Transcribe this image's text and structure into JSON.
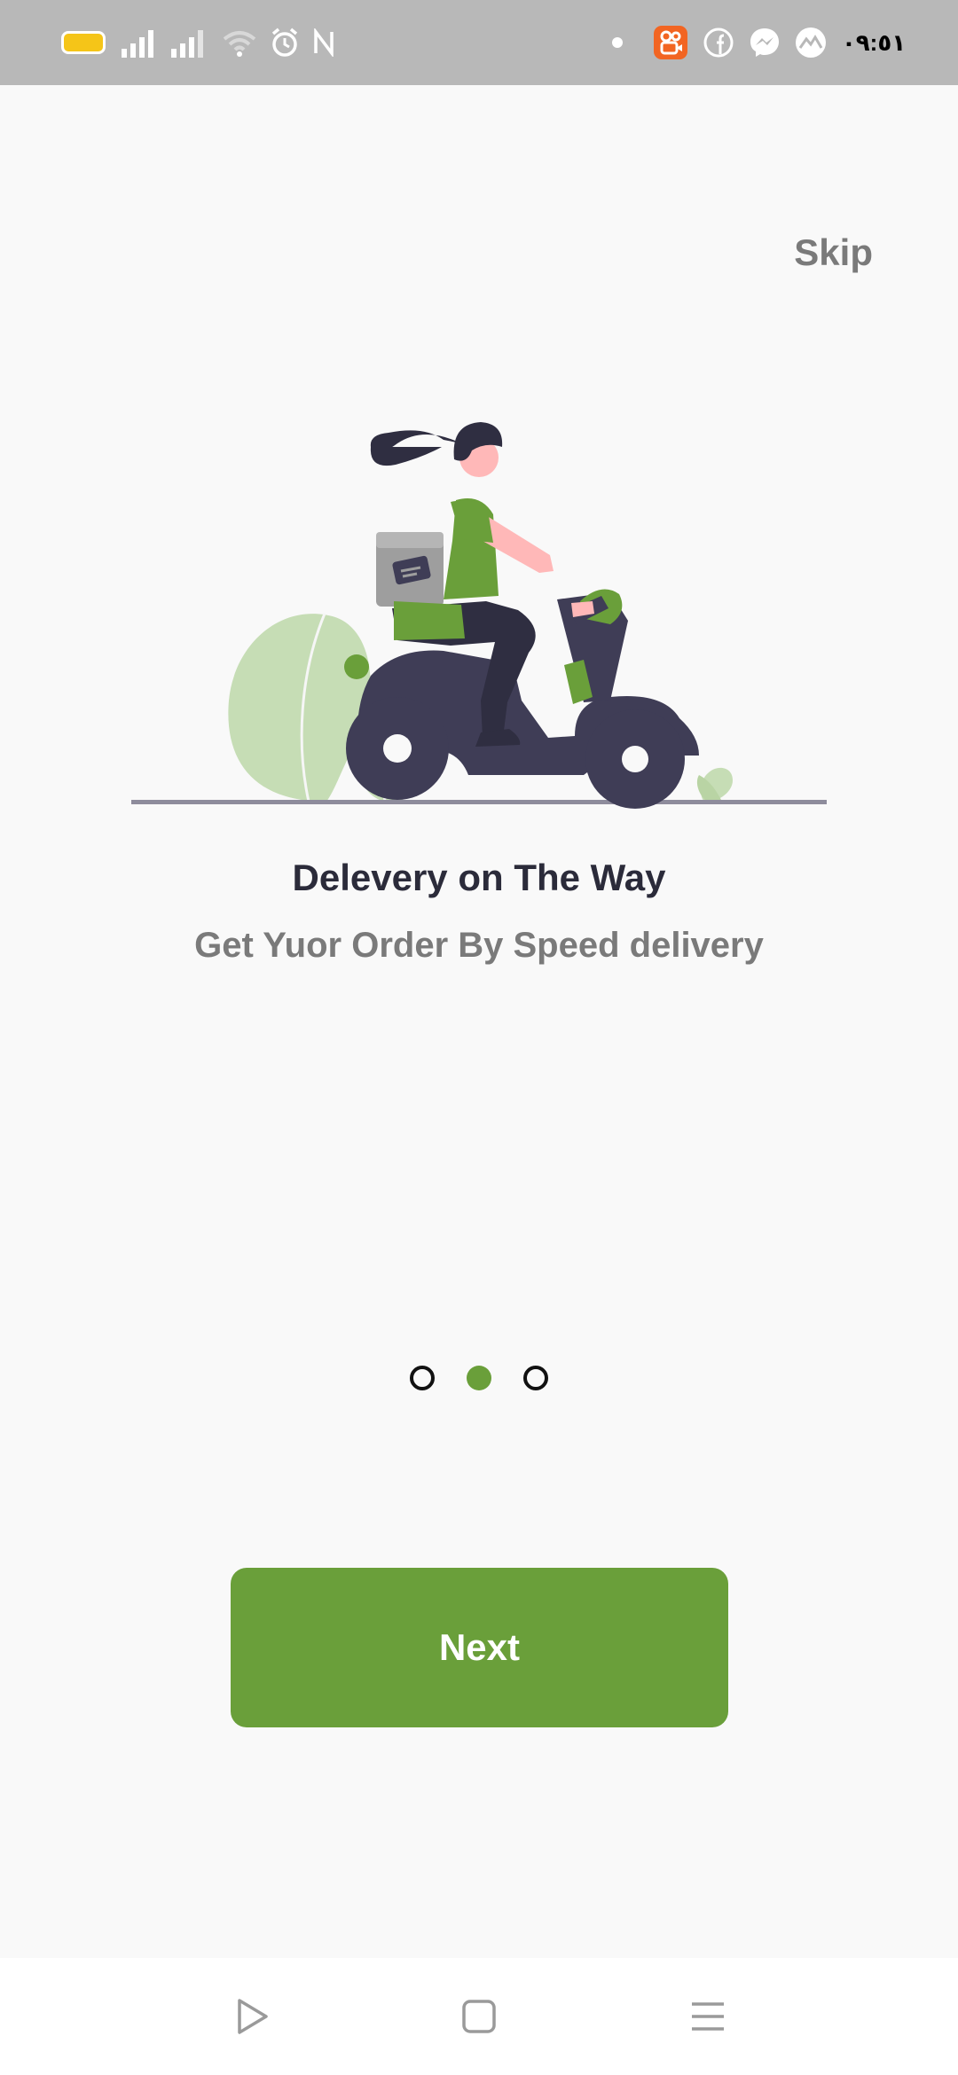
{
  "status_bar": {
    "time": "٠٩:٥١",
    "icons": [
      "battery-icon",
      "signal-icon",
      "signal-icon",
      "wifi-icon",
      "alarm-icon",
      "nfc-icon",
      "notification-dot-icon",
      "kuaishou-app-icon",
      "facebook-icon",
      "messenger-icon",
      "gallery-app-icon"
    ],
    "battery_color": "#f5c518"
  },
  "onboarding": {
    "skip_label": "Skip",
    "illustration": "delivery-scooter-illustration",
    "title": "Delevery on The Way",
    "subtitle": "Get Yuor Order By Speed delivery",
    "page_count": 3,
    "current_page": 2,
    "next_label": "Next"
  },
  "nav_bar": {
    "buttons": [
      "back-icon",
      "home-icon",
      "menu-icon"
    ]
  },
  "colors": {
    "accent": "#6a9f3a",
    "background": "#f9f9f9",
    "title": "#2b2b3a",
    "subtitle": "#7a7a7a",
    "status_bar": "#b8b8b8"
  }
}
